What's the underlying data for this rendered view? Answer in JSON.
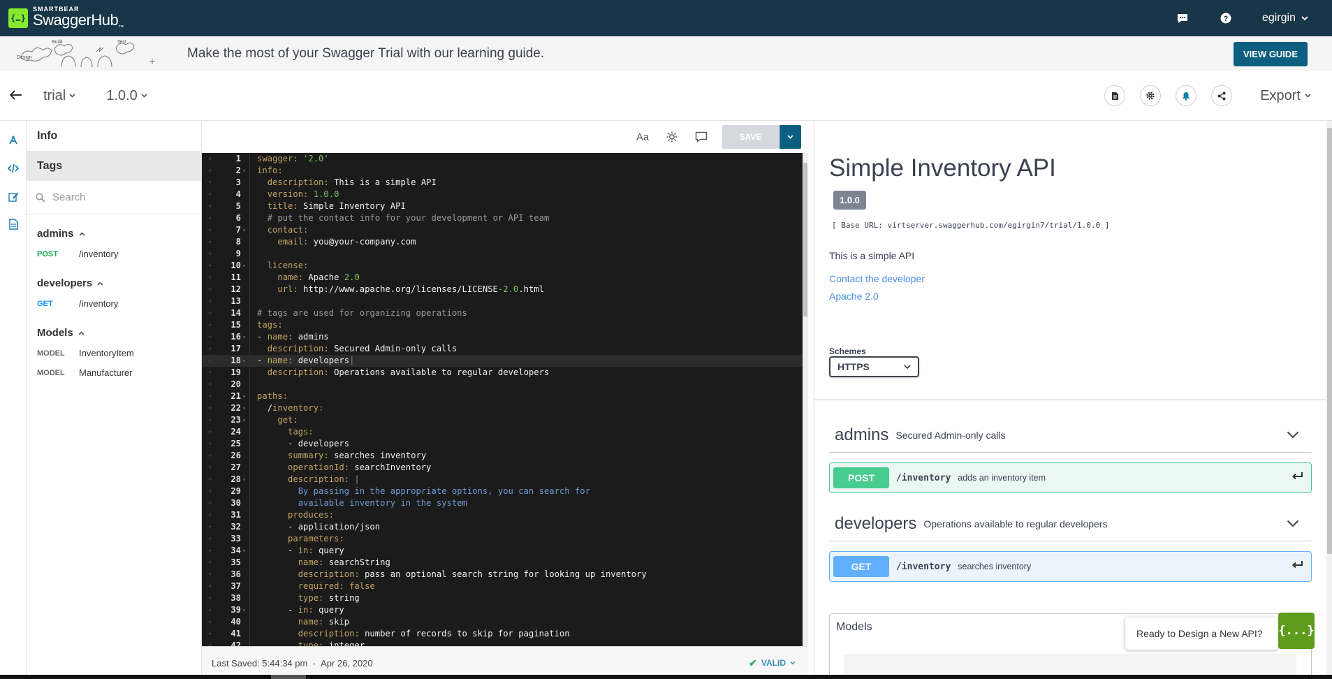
{
  "navbar": {
    "brand_small": "SMARTBEAR",
    "brand_big": "SwaggerHub",
    "user": "egirgin"
  },
  "banner": {
    "art_labels": [
      "Design",
      "Build",
      "Test"
    ],
    "message": "Make the most of your Swagger Trial with our learning guide.",
    "button": "VIEW GUIDE"
  },
  "api_header": {
    "name": "trial",
    "version": "1.0.0",
    "export": "Export"
  },
  "nav": {
    "info": "Info",
    "tags": "Tags",
    "search_placeholder": "Search",
    "groups": [
      {
        "title": "admins",
        "ops": [
          {
            "method": "POST",
            "path": "/inventory"
          }
        ]
      },
      {
        "title": "developers",
        "ops": [
          {
            "method": "GET",
            "path": "/inventory"
          }
        ]
      },
      {
        "title": "Models",
        "ops": [
          {
            "method": "MODEL",
            "path": "InventoryItem"
          },
          {
            "method": "MODEL",
            "path": "Manufacturer"
          }
        ]
      }
    ]
  },
  "editor": {
    "font_toggle": "Aa",
    "save": "SAVE",
    "last_saved_label": "Last Saved:",
    "last_saved_time": "5:44:34 pm",
    "separator": "-",
    "last_saved_date": "Apr 26, 2020",
    "status": "VALID",
    "highlighted_line": 18,
    "lines": [
      {
        "n": 1,
        "fold": false,
        "indent": "",
        "key": "swagger",
        "sep": ": ",
        "val": "'2.0'",
        "vt": "n"
      },
      {
        "n": 2,
        "fold": true,
        "indent": "",
        "key": "info",
        "sep": ":",
        "val": "",
        "vt": "v"
      },
      {
        "n": 3,
        "fold": false,
        "indent": "  ",
        "key": "description",
        "sep": ": ",
        "val": "This is a simple API",
        "vt": "v"
      },
      {
        "n": 4,
        "fold": false,
        "indent": "  ",
        "key": "version",
        "sep": ": ",
        "val": "1.0.0",
        "vt": "n"
      },
      {
        "n": 5,
        "fold": false,
        "indent": "  ",
        "key": "title",
        "sep": ": ",
        "val": "Simple Inventory API",
        "vt": "v"
      },
      {
        "n": 6,
        "fold": false,
        "indent": "  ",
        "key": "",
        "sep": "",
        "val": "# put the contact info for your development or API team",
        "vt": "c"
      },
      {
        "n": 7,
        "fold": true,
        "indent": "  ",
        "key": "contact",
        "sep": ":",
        "val": "",
        "vt": "v"
      },
      {
        "n": 8,
        "fold": false,
        "indent": "    ",
        "key": "email",
        "sep": ": ",
        "val": "you@your-company.com",
        "vt": "v"
      },
      {
        "n": 9,
        "fold": false,
        "indent": "",
        "key": "",
        "sep": "",
        "val": "",
        "vt": "v"
      },
      {
        "n": 10,
        "fold": true,
        "indent": "  ",
        "key": "license",
        "sep": ":",
        "val": "",
        "vt": "v"
      },
      {
        "n": 11,
        "fold": false,
        "indent": "    ",
        "key": "name",
        "sep": ": ",
        "val": "Apache ",
        "vt": "v",
        "val2": "2.0",
        "vt2": "n"
      },
      {
        "n": 12,
        "fold": false,
        "indent": "    ",
        "key": "url",
        "sep": ": ",
        "val": "http://www.apache.org/licenses/LICENSE",
        "vt": "v",
        "val2": "-2.0",
        "vt2": "n",
        "val3": ".html",
        "vt3": "v"
      },
      {
        "n": 13,
        "fold": false,
        "indent": "",
        "key": "",
        "sep": "",
        "val": "",
        "vt": "v"
      },
      {
        "n": 14,
        "fold": false,
        "indent": "",
        "key": "",
        "sep": "",
        "val": "# tags are used for organizing operations",
        "vt": "c"
      },
      {
        "n": 15,
        "fold": false,
        "indent": "",
        "key": "tags",
        "sep": ":",
        "val": "",
        "vt": "v"
      },
      {
        "n": 16,
        "fold": true,
        "indent": "- ",
        "key": "name",
        "sep": ": ",
        "val": "admins",
        "vt": "v"
      },
      {
        "n": 17,
        "fold": false,
        "indent": "  ",
        "key": "description",
        "sep": ": ",
        "val": "Secured Admin-only calls",
        "vt": "v"
      },
      {
        "n": 18,
        "fold": true,
        "indent": "- ",
        "key": "name",
        "sep": ": ",
        "val": "developers",
        "vt": "v"
      },
      {
        "n": 19,
        "fold": false,
        "indent": "  ",
        "key": "description",
        "sep": ": ",
        "val": "Operations available to regular developers",
        "vt": "v"
      },
      {
        "n": 20,
        "fold": false,
        "indent": "",
        "key": "",
        "sep": "",
        "val": "",
        "vt": "v"
      },
      {
        "n": 21,
        "fold": true,
        "indent": "",
        "key": "paths",
        "sep": ":",
        "val": "",
        "vt": "v"
      },
      {
        "n": 22,
        "fold": true,
        "indent": "  ",
        "key": "",
        "sep": "",
        "val": "/inventory:",
        "vt": "path"
      },
      {
        "n": 23,
        "fold": true,
        "indent": "    ",
        "key": "get",
        "sep": ":",
        "val": "",
        "vt": "v"
      },
      {
        "n": 24,
        "fold": false,
        "indent": "      ",
        "key": "tags",
        "sep": ":",
        "val": "",
        "vt": "v"
      },
      {
        "n": 25,
        "fold": false,
        "indent": "      ",
        "key": "",
        "sep": "",
        "val": "- developers",
        "vt": "v"
      },
      {
        "n": 26,
        "fold": false,
        "indent": "      ",
        "key": "summary",
        "sep": ": ",
        "val": "searches inventory",
        "vt": "v"
      },
      {
        "n": 27,
        "fold": false,
        "indent": "      ",
        "key": "operationId",
        "sep": ": ",
        "val": "searchInventory",
        "vt": "v"
      },
      {
        "n": 28,
        "fold": true,
        "indent": "      ",
        "key": "description",
        "sep": ": ",
        "val": "|",
        "vt": "b"
      },
      {
        "n": 29,
        "fold": false,
        "indent": "        ",
        "key": "",
        "sep": "",
        "val": "By passing in the appropriate options, you can search for",
        "vt": "b"
      },
      {
        "n": 30,
        "fold": false,
        "indent": "        ",
        "key": "",
        "sep": "",
        "val": "available inventory in the system",
        "vt": "b"
      },
      {
        "n": 31,
        "fold": false,
        "indent": "      ",
        "key": "produces",
        "sep": ":",
        "val": "",
        "vt": "v"
      },
      {
        "n": 32,
        "fold": false,
        "indent": "      ",
        "key": "",
        "sep": "",
        "val": "- application/json",
        "vt": "v"
      },
      {
        "n": 33,
        "fold": false,
        "indent": "      ",
        "key": "parameters",
        "sep": ":",
        "val": "",
        "vt": "v"
      },
      {
        "n": 34,
        "fold": true,
        "indent": "      - ",
        "key": "in",
        "sep": ": ",
        "val": "query",
        "vt": "v"
      },
      {
        "n": 35,
        "fold": false,
        "indent": "        ",
        "key": "name",
        "sep": ": ",
        "val": "searchString",
        "vt": "v"
      },
      {
        "n": 36,
        "fold": false,
        "indent": "        ",
        "key": "description",
        "sep": ": ",
        "val": "pass an optional search string for looking up inventory",
        "vt": "v"
      },
      {
        "n": 37,
        "fold": false,
        "indent": "        ",
        "key": "required",
        "sep": ": ",
        "val": "false",
        "vt": "k"
      },
      {
        "n": 38,
        "fold": false,
        "indent": "        ",
        "key": "type",
        "sep": ": ",
        "val": "string",
        "vt": "v"
      },
      {
        "n": 39,
        "fold": true,
        "indent": "      - ",
        "key": "in",
        "sep": ": ",
        "val": "query",
        "vt": "v"
      },
      {
        "n": 40,
        "fold": false,
        "indent": "        ",
        "key": "name",
        "sep": ": ",
        "val": "skip",
        "vt": "v"
      },
      {
        "n": 41,
        "fold": false,
        "indent": "        ",
        "key": "description",
        "sep": ": ",
        "val": "number of records to skip for pagination",
        "vt": "v"
      },
      {
        "n": 42,
        "fold": false,
        "indent": "        ",
        "key": "type",
        "sep": ": ",
        "val": "integer",
        "vt": "v"
      }
    ]
  },
  "docs": {
    "title": "Simple Inventory API",
    "version": "1.0.0",
    "base_url": "[ Base URL: virtserver.swaggerhub.com/egirgin7/trial/1.0.0 ]",
    "description": "This is a simple API",
    "contact_link": "Contact the developer",
    "license_link": "Apache 2.0",
    "schemes_label": "Schemes",
    "scheme": "HTTPS",
    "sections": [
      {
        "tag": "admins",
        "desc": "Secured Admin-only calls",
        "method": "POST",
        "path": "/inventory",
        "summary": "adds an inventory item"
      },
      {
        "tag": "developers",
        "desc": "Operations available to regular developers",
        "method": "GET",
        "path": "/inventory",
        "summary": "searches inventory"
      }
    ],
    "models_title": "Models"
  },
  "chat": {
    "prompt": "Ready to Design a New API?",
    "button": "{...}"
  },
  "colors": {
    "navbar": "#173647",
    "accent": "#0c5f80",
    "post": "#49cc90",
    "get": "#61affe",
    "brand": "#85ea2d"
  }
}
